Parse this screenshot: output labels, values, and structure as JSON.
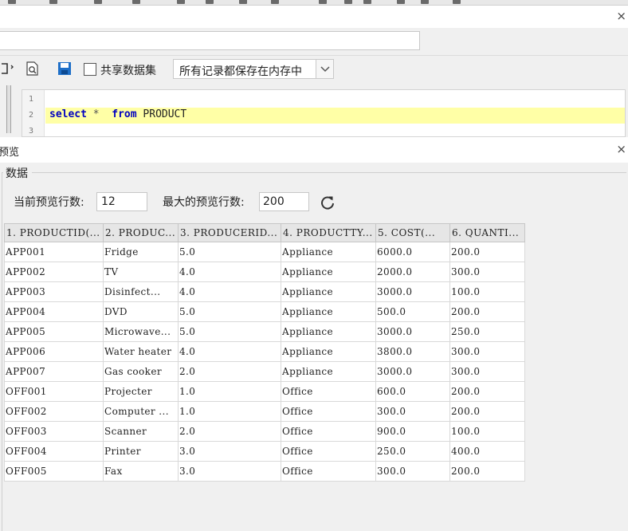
{
  "window": {
    "close_glyph": "×"
  },
  "toolbar": {
    "share_label": "共享数据集",
    "memory_mode": "所有记录都保存在内存中"
  },
  "editor": {
    "line_numbers": [
      "1",
      "2",
      "3"
    ],
    "sql": {
      "kw_select": "select",
      "star": "*",
      "kw_from": "from",
      "table": "PRODUCT"
    }
  },
  "preview": {
    "title": "预览",
    "section_label": "数据",
    "current_rows_label": "当前预览行数:",
    "current_rows_value": "12",
    "max_rows_label": "最大的预览行数:",
    "max_rows_value": "200"
  },
  "table": {
    "columns": [
      "1. PRODUCTID(...",
      "2. PRODUC...",
      "3. PRODUCERID...",
      "4. PRODUCTTY...",
      "5. COST(...",
      "6. QUANTI..."
    ],
    "rows": [
      [
        "APP001",
        "Fridge",
        "5.0",
        "Appliance",
        "6000.0",
        "200.0"
      ],
      [
        "APP002",
        "TV",
        "4.0",
        "Appliance",
        "2000.0",
        "300.0"
      ],
      [
        "APP003",
        "Disinfect...",
        "4.0",
        "Appliance",
        "3000.0",
        "100.0"
      ],
      [
        "APP004",
        "DVD",
        "5.0",
        "Appliance",
        "500.0",
        "200.0"
      ],
      [
        "APP005",
        "Microwave...",
        "5.0",
        "Appliance",
        "3000.0",
        "250.0"
      ],
      [
        "APP006",
        "Water heater",
        "4.0",
        "Appliance",
        "3800.0",
        "300.0"
      ],
      [
        "APP007",
        "Gas cooker",
        "2.0",
        "Appliance",
        "3000.0",
        "300.0"
      ],
      [
        "OFF001",
        "Projecter",
        "1.0",
        "Office",
        "600.0",
        "200.0"
      ],
      [
        "OFF002",
        "Computer ...",
        "1.0",
        "Office",
        "300.0",
        "200.0"
      ],
      [
        "OFF003",
        "Scanner",
        "2.0",
        "Office",
        "900.0",
        "100.0"
      ],
      [
        "OFF004",
        "Printer",
        "3.0",
        "Office",
        "250.0",
        "400.0"
      ],
      [
        "OFF005",
        "Fax",
        "3.0",
        "Office",
        "300.0",
        "200.0"
      ]
    ]
  },
  "icons": [
    "preview-file-icon",
    "save-icon",
    "chevron-down-icon",
    "refresh-icon",
    "close-icon"
  ]
}
